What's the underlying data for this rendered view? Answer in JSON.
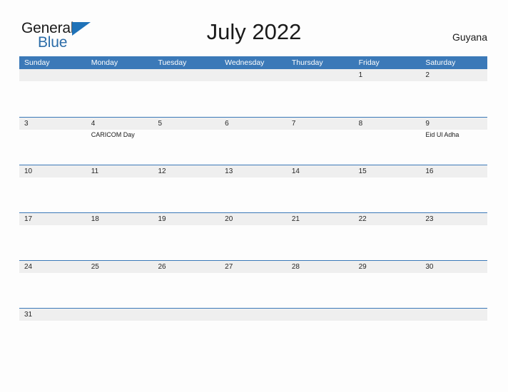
{
  "logo": {
    "word_one": "General",
    "word_two": "Blue",
    "triangle_color": "#1f72b8",
    "blue_color": "#2b6ca8"
  },
  "header": {
    "title": "July 2022",
    "country": "Guyana"
  },
  "theme": {
    "header_blue": "#3b79b8",
    "daynum_band": "#efefef",
    "page_background": "#fdfdfd",
    "separator_blue": "#3b79b8"
  },
  "calendar": {
    "weekdays": [
      "Sunday",
      "Monday",
      "Tuesday",
      "Wednesday",
      "Thursday",
      "Friday",
      "Saturday"
    ],
    "weeks": [
      [
        {
          "day": "",
          "event": ""
        },
        {
          "day": "",
          "event": ""
        },
        {
          "day": "",
          "event": ""
        },
        {
          "day": "",
          "event": ""
        },
        {
          "day": "",
          "event": ""
        },
        {
          "day": "1",
          "event": ""
        },
        {
          "day": "2",
          "event": ""
        }
      ],
      [
        {
          "day": "3",
          "event": ""
        },
        {
          "day": "4",
          "event": "CARICOM Day"
        },
        {
          "day": "5",
          "event": ""
        },
        {
          "day": "6",
          "event": ""
        },
        {
          "day": "7",
          "event": ""
        },
        {
          "day": "8",
          "event": ""
        },
        {
          "day": "9",
          "event": "Eid Ul Adha"
        }
      ],
      [
        {
          "day": "10",
          "event": ""
        },
        {
          "day": "11",
          "event": ""
        },
        {
          "day": "12",
          "event": ""
        },
        {
          "day": "13",
          "event": ""
        },
        {
          "day": "14",
          "event": ""
        },
        {
          "day": "15",
          "event": ""
        },
        {
          "day": "16",
          "event": ""
        }
      ],
      [
        {
          "day": "17",
          "event": ""
        },
        {
          "day": "18",
          "event": ""
        },
        {
          "day": "19",
          "event": ""
        },
        {
          "day": "20",
          "event": ""
        },
        {
          "day": "21",
          "event": ""
        },
        {
          "day": "22",
          "event": ""
        },
        {
          "day": "23",
          "event": ""
        }
      ],
      [
        {
          "day": "24",
          "event": ""
        },
        {
          "day": "25",
          "event": ""
        },
        {
          "day": "26",
          "event": ""
        },
        {
          "day": "27",
          "event": ""
        },
        {
          "day": "28",
          "event": ""
        },
        {
          "day": "29",
          "event": ""
        },
        {
          "day": "30",
          "event": ""
        }
      ],
      [
        {
          "day": "31",
          "event": ""
        },
        {
          "day": "",
          "event": ""
        },
        {
          "day": "",
          "event": ""
        },
        {
          "day": "",
          "event": ""
        },
        {
          "day": "",
          "event": ""
        },
        {
          "day": "",
          "event": ""
        },
        {
          "day": "",
          "event": ""
        }
      ]
    ]
  }
}
